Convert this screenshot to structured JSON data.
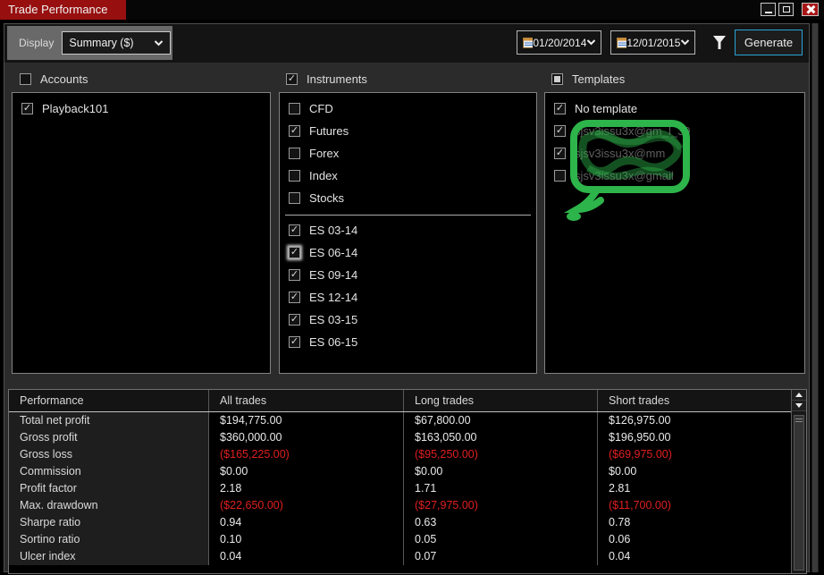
{
  "window": {
    "title": "Trade Performance",
    "controls": {
      "minimize": "minimize",
      "maximize": "maximize",
      "close": "close"
    }
  },
  "toolbar": {
    "display_label": "Display",
    "display_value": "Summary ($)",
    "date_from": "01/20/2014",
    "date_to": "12/01/2015",
    "generate_label": "Generate"
  },
  "sections": {
    "accounts": {
      "label": "Accounts",
      "checked": false,
      "items": [
        {
          "label": "Playback101",
          "checked": true
        }
      ]
    },
    "instruments": {
      "label": "Instruments",
      "checked": true,
      "types": [
        {
          "label": "CFD",
          "checked": false
        },
        {
          "label": "Futures",
          "checked": true
        },
        {
          "label": "Forex",
          "checked": false
        },
        {
          "label": "Index",
          "checked": false
        },
        {
          "label": "Stocks",
          "checked": false
        }
      ],
      "contracts": [
        {
          "label": "ES 03-14",
          "checked": true
        },
        {
          "label": "ES 06-14",
          "checked": true,
          "focused": true
        },
        {
          "label": "ES 09-14",
          "checked": true
        },
        {
          "label": "ES 12-14",
          "checked": true
        },
        {
          "label": "ES 03-15",
          "checked": true
        },
        {
          "label": "ES 06-15",
          "checked": true
        }
      ]
    },
    "templates": {
      "label": "Templates",
      "state": "indeterminate",
      "items": [
        {
          "label": "No template",
          "checked": true,
          "obscured": false
        },
        {
          "label": "sjsv3issu3x@gm_l_39",
          "checked": true,
          "obscured": true
        },
        {
          "label": "sjsv3issu3x@mm",
          "checked": true,
          "obscured": true
        },
        {
          "label": "sjsv3issu3x@gmail",
          "checked": false,
          "obscured": true
        }
      ],
      "redaction": {
        "type": "green-marker-scribble",
        "color": "#2db44a"
      }
    }
  },
  "table": {
    "columns": [
      "Performance",
      "All trades",
      "Long trades",
      "Short trades"
    ],
    "rows": [
      {
        "label": "Total net profit",
        "values": [
          "$194,775.00",
          "$67,800.00",
          "$126,975.00"
        ],
        "negative": false
      },
      {
        "label": "Gross profit",
        "values": [
          "$360,000.00",
          "$163,050.00",
          "$196,950.00"
        ],
        "negative": false
      },
      {
        "label": "Gross loss",
        "values": [
          "($165,225.00)",
          "($95,250.00)",
          "($69,975.00)"
        ],
        "negative": true
      },
      {
        "label": "Commission",
        "values": [
          "$0.00",
          "$0.00",
          "$0.00"
        ],
        "negative": false
      },
      {
        "label": "Profit factor",
        "values": [
          "2.18",
          "1.71",
          "2.81"
        ],
        "negative": false
      },
      {
        "label": "Max. drawdown",
        "values": [
          "($22,650.00)",
          "($27,975.00)",
          "($11,700.00)"
        ],
        "negative": true
      },
      {
        "label": "Sharpe ratio",
        "values": [
          "0.94",
          "0.63",
          "0.78"
        ],
        "negative": false
      },
      {
        "label": "Sortino ratio",
        "values": [
          "0.10",
          "0.05",
          "0.06"
        ],
        "negative": false
      },
      {
        "label": "Ulcer index",
        "values": [
          "0.04",
          "0.07",
          "0.04"
        ],
        "negative": false
      }
    ]
  },
  "colors": {
    "title_red": "#970f0f",
    "negative_value": "#e01f1f",
    "generate_border": "#2aa3d6",
    "redaction_green": "#2db44a"
  }
}
